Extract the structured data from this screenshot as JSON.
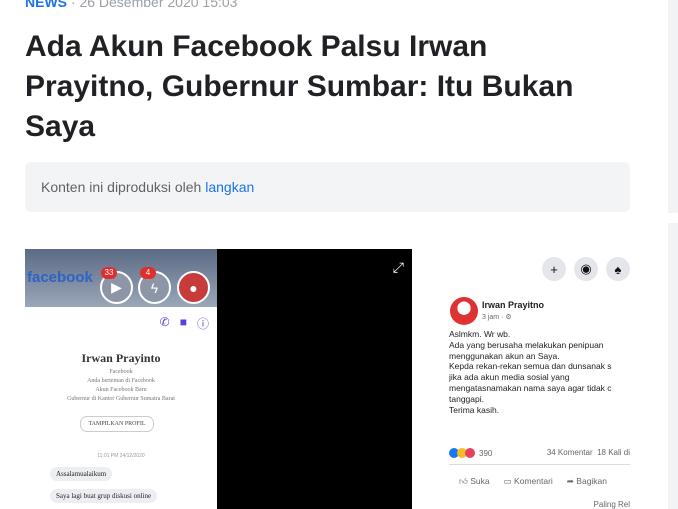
{
  "meta": {
    "category": "NEWS",
    "date": "· 26 Desember 2020 15:03"
  },
  "article": {
    "title": "Ada Akun Facebook Palsu Irwan Prayitno, Gubernur Sumbar: Itu Bukan Saya"
  },
  "byline": {
    "prefix": "Konten ini diproduksi oleh ",
    "source": "langkan"
  },
  "screenshot": {
    "phone": {
      "brand": "facebook",
      "badge_left": "33",
      "badge_right": "4",
      "profile_name": "Irwan Prayinto",
      "profile_lines": [
        "Facebook",
        "Anda berteman di Facebook",
        "Akun Facebook Baru",
        "Gubernur di Kantor Gubernur Sumatra Barat"
      ],
      "profile_button": "TAMPILKAN PROFIL",
      "time_label": "11:01 PM 24/12/2020",
      "messages": [
        "Assalamualaikum",
        "Saya lagi buat grup diskusi online"
      ]
    },
    "post": {
      "author": "Irwan Prayitno",
      "time": "3 jam · ⚙",
      "body": [
        "Aslmkm. Wr wb.",
        "Ada yang berusaha melakukan penipuan",
        "menggunakan akun an Saya.",
        "Kepda rekan-rekan semua dan dunsanak s",
        "jika ada akun media sosial yang",
        "mengatasnamakan nama saya agar tidak c",
        "tanggapi.",
        "Terima kasih."
      ],
      "reaction_count": "390",
      "comments": "34 Komentar",
      "shares": "18 Kali di",
      "actions": {
        "like": "Suka",
        "comment": "Komentari",
        "share": "Bagikan"
      },
      "sort": "Paling Rel"
    }
  }
}
